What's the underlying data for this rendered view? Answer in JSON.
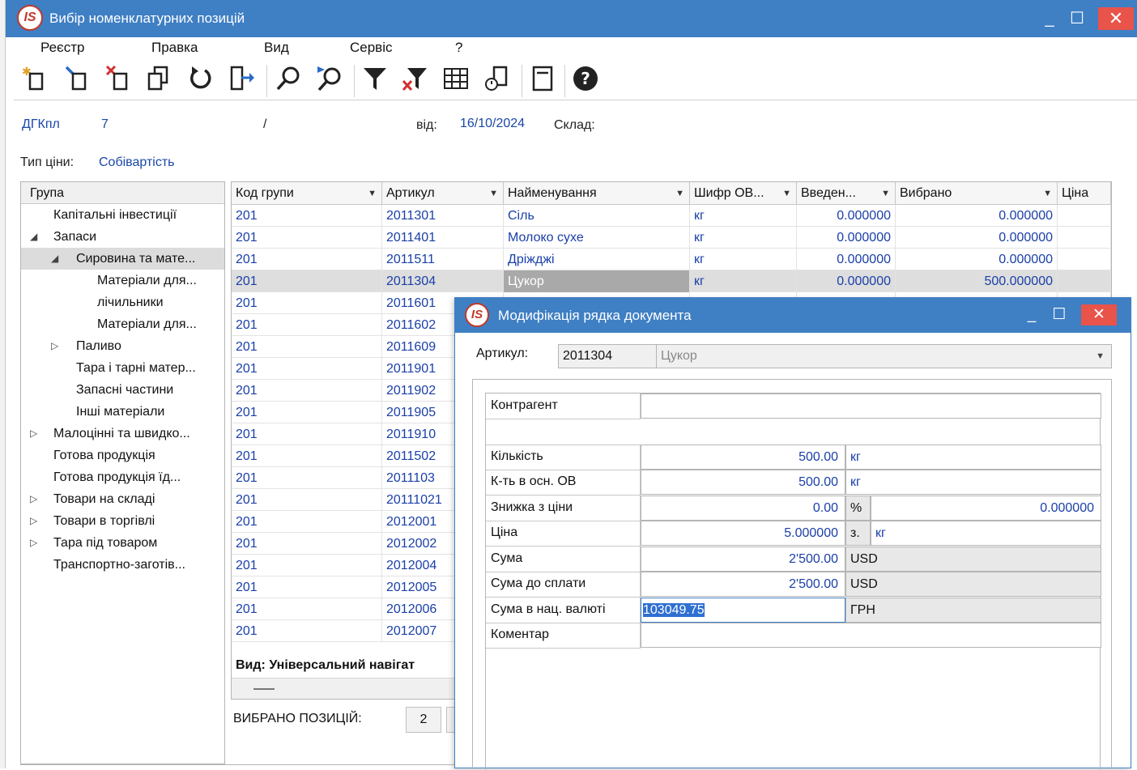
{
  "window": {
    "logo": "IS",
    "title": "Вибір номенклатурних позицій",
    "controls": {
      "minimize": "_",
      "maximize": "☐",
      "close": "✕"
    }
  },
  "menu": [
    "Реєстр",
    "Правка",
    "Вид",
    "Сервіс",
    "?"
  ],
  "toolbar_icons": [
    "add-icon",
    "edit-icon",
    "delete-icon",
    "copy-icon",
    "refresh-icon",
    "export-icon",
    "search-icon",
    "search-next-icon",
    "filter-icon",
    "clear-filter-icon",
    "table-view-icon",
    "history-icon",
    "form-icon",
    "help-icon"
  ],
  "header": {
    "doc_label": "ДГКпл",
    "doc_number": "7",
    "separator": "/",
    "from_label": "від:",
    "date": "16/10/2024",
    "warehouse_label": "Склад:",
    "price_type_label": "Тип ціни:",
    "price_type_value": "Собівартість"
  },
  "tree": {
    "header": "Група",
    "items": [
      {
        "label": "Капітальні інвестиції",
        "level": 0,
        "expander": ""
      },
      {
        "label": "Запаси",
        "level": 0,
        "expander": "◢"
      },
      {
        "label": "Сировина та мате...",
        "level": 1,
        "expander": "◢",
        "selected": true
      },
      {
        "label": "Матеріали для...",
        "level": 2,
        "expander": ""
      },
      {
        "label": "лічильники",
        "level": 2,
        "expander": ""
      },
      {
        "label": "Матеріали для...",
        "level": 2,
        "expander": ""
      },
      {
        "label": "Паливо",
        "level": 1,
        "expander": "▷"
      },
      {
        "label": "Тара і тарні матер...",
        "level": 1,
        "expander": ""
      },
      {
        "label": "Запасні частини",
        "level": 1,
        "expander": ""
      },
      {
        "label": "Інші матеріали",
        "level": 1,
        "expander": ""
      },
      {
        "label": "Малоцінні та швидко...",
        "level": 0,
        "expander": "▷"
      },
      {
        "label": "Готова продукція",
        "level": 0,
        "expander": ""
      },
      {
        "label": "Готова продукція їд...",
        "level": 0,
        "expander": ""
      },
      {
        "label": "Товари на складі",
        "level": 0,
        "expander": "▷"
      },
      {
        "label": "Товари в  торгівлі",
        "level": 0,
        "expander": "▷"
      },
      {
        "label": "Тара під товаром",
        "level": 0,
        "expander": "▷"
      },
      {
        "label": "Транспортно-заготів...",
        "level": 0,
        "expander": ""
      }
    ]
  },
  "grid": {
    "columns": [
      "Код групи",
      "Артикул",
      "Найменування",
      "Шифр ОВ...",
      "Введен...",
      "Вибрано",
      "Ціна"
    ],
    "rows": [
      {
        "group": "201",
        "article": "2011301",
        "name": "Сіль",
        "unit": "кг",
        "entered": "0.000000",
        "chosen": "0.000000"
      },
      {
        "group": "201",
        "article": "2011401",
        "name": "Молоко сухе",
        "unit": "кг",
        "entered": "0.000000",
        "chosen": "0.000000"
      },
      {
        "group": "201",
        "article": "2011511",
        "name": "Дріжджі",
        "unit": "кг",
        "entered": "0.000000",
        "chosen": "0.000000"
      },
      {
        "group": "201",
        "article": "2011304",
        "name": "Цукор",
        "unit": "кг",
        "entered": "0.000000",
        "chosen": "500.000000",
        "selected": true
      },
      {
        "group": "201",
        "article": "2011601"
      },
      {
        "group": "201",
        "article": "2011602"
      },
      {
        "group": "201",
        "article": "2011609"
      },
      {
        "group": "201",
        "article": "2011901"
      },
      {
        "group": "201",
        "article": "2011902"
      },
      {
        "group": "201",
        "article": "2011905"
      },
      {
        "group": "201",
        "article": "2011910"
      },
      {
        "group": "201",
        "article": "2011502"
      },
      {
        "group": "201",
        "article": "2011103"
      },
      {
        "group": "201",
        "article": "20111021"
      },
      {
        "group": "201",
        "article": "2012001"
      },
      {
        "group": "201",
        "article": "2012002"
      },
      {
        "group": "201",
        "article": "2012004"
      },
      {
        "group": "201",
        "article": "2012005"
      },
      {
        "group": "201",
        "article": "2012006"
      },
      {
        "group": "201",
        "article": "2012007"
      }
    ],
    "view_text": "Вид: Універсальний навігат"
  },
  "footer": {
    "selected_label": "ВИБРАНО ПОЗИЦІЙ:",
    "selected_count": "2"
  },
  "dialog": {
    "logo": "IS",
    "title": "Модифікація рядка документа",
    "controls": {
      "minimize": "_",
      "maximize": "☐",
      "close": "✕"
    },
    "article_label": "Артикул:",
    "article_code": "2011304",
    "article_name": "Цукор",
    "fields": {
      "contractor_label": "Контрагент",
      "quantity_label": "Кількість",
      "quantity_value": "500.00",
      "quantity_unit": "кг",
      "qty_base_label": "К-ть в осн. ОВ",
      "qty_base_value": "500.00",
      "qty_base_unit": "кг",
      "discount_label": "Знижка з ціни",
      "discount_value": "0.00",
      "discount_unit": "%",
      "discount_amount": "0.000000",
      "price_label": "Ціна",
      "price_value": "5.000000",
      "price_per": "з.",
      "price_unit": "кг",
      "sum_label": "Сума",
      "sum_value": "2'500.00",
      "sum_currency": "USD",
      "sum_pay_label": "Сума до сплати",
      "sum_pay_value": "2'500.00",
      "sum_pay_currency": "USD",
      "sum_national_label": "Сума в нац. валюті",
      "sum_national_value": "103049.75",
      "sum_national_currency": "ГРН",
      "comment_label": "Коментар"
    }
  }
}
